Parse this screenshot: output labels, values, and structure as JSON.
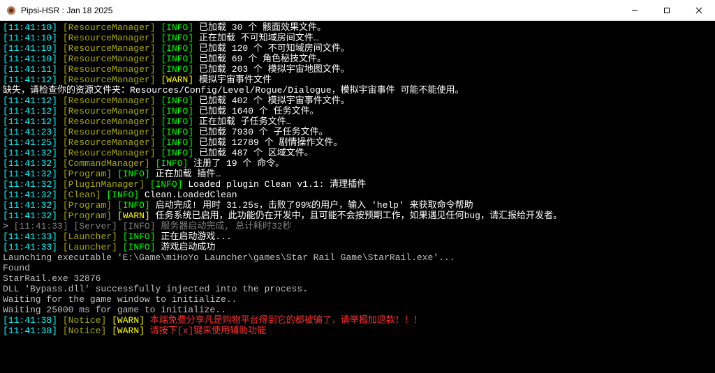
{
  "window": {
    "title": "Pipsi-HSR : Jan 18 2025"
  },
  "lines": [
    {
      "ts": "11:41:10",
      "src": "ResourceManager",
      "srcClass": "c-dkyel",
      "lvl": "INFO",
      "lvlClass": "c-green",
      "msg": "已加载 30 个 骸面效果文件。",
      "msgClass": "c-white"
    },
    {
      "ts": "11:41:10",
      "src": "ResourceManager",
      "srcClass": "c-dkyel",
      "lvl": "INFO",
      "lvlClass": "c-green",
      "msg": "正在加载 不可知域房间文件…",
      "msgClass": "c-white"
    },
    {
      "ts": "11:41:10",
      "src": "ResourceManager",
      "srcClass": "c-dkyel",
      "lvl": "INFO",
      "lvlClass": "c-green",
      "msg": "已加载 120 个 不可知域房间文件。",
      "msgClass": "c-white"
    },
    {
      "ts": "11:41:10",
      "src": "ResourceManager",
      "srcClass": "c-dkyel",
      "lvl": "INFO",
      "lvlClass": "c-green",
      "msg": "已加载 69 个 角色秘技文件。",
      "msgClass": "c-white"
    },
    {
      "ts": "11:41:11",
      "src": "ResourceManager",
      "srcClass": "c-dkyel",
      "lvl": "INFO",
      "lvlClass": "c-green",
      "msg": "已加载 203 个 模拟宇宙地图文件。",
      "msgClass": "c-white"
    },
    {
      "ts": "11:41:12",
      "src": "ResourceManager",
      "srcClass": "c-dkyel",
      "lvl": "WARN",
      "lvlClass": "c-yellow",
      "msg": "模拟宇宙事件文件",
      "msgClass": "c-white"
    },
    {
      "plain": true,
      "msg": "缺失，请检查你的资源文件夹：Resources/Config/Level/Rogue/Dialogue，模拟宇宙事件 可能不能使用。",
      "msgClass": "c-white"
    },
    {
      "ts": "11:41:12",
      "src": "ResourceManager",
      "srcClass": "c-dkyel",
      "lvl": "INFO",
      "lvlClass": "c-green",
      "msg": "已加载 402 个 模拟宇宙事件文件。",
      "msgClass": "c-white"
    },
    {
      "ts": "11:41:12",
      "src": "ResourceManager",
      "srcClass": "c-dkyel",
      "lvl": "INFO",
      "lvlClass": "c-green",
      "msg": "已加载 1640 个 任务文件。",
      "msgClass": "c-white"
    },
    {
      "ts": "11:41:12",
      "src": "ResourceManager",
      "srcClass": "c-dkyel",
      "lvl": "INFO",
      "lvlClass": "c-green",
      "msg": "正在加载 子任务文件…",
      "msgClass": "c-white"
    },
    {
      "ts": "11:41:23",
      "src": "ResourceManager",
      "srcClass": "c-dkyel",
      "lvl": "INFO",
      "lvlClass": "c-green",
      "msg": "已加载 7930 个 子任务文件。",
      "msgClass": "c-white"
    },
    {
      "ts": "11:41:25",
      "src": "ResourceManager",
      "srcClass": "c-dkyel",
      "lvl": "INFO",
      "lvlClass": "c-green",
      "msg": "已加载 12789 个 剧情操作文件。",
      "msgClass": "c-white"
    },
    {
      "ts": "11:41:32",
      "src": "ResourceManager",
      "srcClass": "c-dkyel",
      "lvl": "INFO",
      "lvlClass": "c-green",
      "msg": "已加载 487 个 区域文件。",
      "msgClass": "c-white"
    },
    {
      "ts": "11:41:32",
      "src": "CommandManager",
      "srcClass": "c-dkyel",
      "lvl": "INFO",
      "lvlClass": "c-green",
      "msg": "注册了 19 个 命令。",
      "msgClass": "c-white"
    },
    {
      "ts": "11:41:32",
      "src": "Program",
      "srcClass": "c-dkyel",
      "lvl": "INFO",
      "lvlClass": "c-green",
      "msg": "正在加载 插件…",
      "msgClass": "c-white"
    },
    {
      "ts": "11:41:32",
      "src": "PluginManager",
      "srcClass": "c-dkyel",
      "lvl": "INFO",
      "lvlClass": "c-green",
      "msg": "Loaded plugin Clean v1.1: 清理插件",
      "msgClass": "c-white"
    },
    {
      "ts": "11:41:32",
      "src": "Clean",
      "srcClass": "c-dkyel",
      "lvl": "INFO",
      "lvlClass": "c-green",
      "msg": "Clean.LoadedClean",
      "msgClass": "c-white"
    },
    {
      "ts": "11:41:32",
      "src": "Program",
      "srcClass": "c-dkyel",
      "lvl": "INFO",
      "lvlClass": "c-green",
      "msg": "启动完成! 用时 31.25s，击败了99%的用户，输入 'help' 来获取命令帮助",
      "msgClass": "c-white"
    },
    {
      "ts": "11:41:32",
      "src": "Program",
      "srcClass": "c-dkyel",
      "lvl": "WARN",
      "lvlClass": "c-yellow",
      "msg": "任务系统已启用，此功能仍在开发中，且可能不会按预期工作，如果遇见任何bug，请汇报给开发者。",
      "msgClass": "c-white"
    },
    {
      "prompt": "> ",
      "ts": "11:41:33",
      "tsClass": "c-dim",
      "src": "Server",
      "srcClass": "c-dim",
      "lvl": "INFO",
      "lvlClass": "c-dim",
      "msg": "服务器启动完成, 总计耗时32秒",
      "msgClass": "c-dim"
    },
    {
      "ts": "11:41:33",
      "src": "Launcher",
      "srcClass": "c-dkyel",
      "lvl": "INFO",
      "lvlClass": "c-green",
      "msg": "正在启动游戏...",
      "msgClass": "c-white"
    },
    {
      "ts": "11:41:33",
      "src": "Launcher",
      "srcClass": "c-dkyel",
      "lvl": "INFO",
      "lvlClass": "c-green",
      "msg": "游戏启动成功",
      "msgClass": "c-white"
    },
    {
      "plain": true,
      "msg": "Launching executable 'E:\\Game\\miHoYo Launcher\\games\\Star Rail Game\\StarRail.exe'...",
      "msgClass": "c-gray"
    },
    {
      "plain": true,
      "msg": "Found",
      "msgClass": "c-gray"
    },
    {
      "plain": true,
      "msg": "StarRail.exe 32876",
      "msgClass": "c-gray"
    },
    {
      "plain": true,
      "msg": "DLL 'Bypass.dll' successfully injected into the process.",
      "msgClass": "c-gray"
    },
    {
      "plain": true,
      "msg": "Waiting for the game window to initialize..",
      "msgClass": "c-gray"
    },
    {
      "plain": true,
      "msg": "Waiting 25000 ms for game to initialize..",
      "msgClass": "c-gray"
    },
    {
      "ts": "11:41:38",
      "src": "Notice",
      "srcClass": "c-dkyel",
      "lvl": "WARN",
      "lvlClass": "c-yellow",
      "msg": "本端免费分享凡是购物平台得到它的都被骗了，请举报加退款！！！",
      "msgClass": "c-red"
    },
    {
      "ts": "11:41:38",
      "src": "Notice",
      "srcClass": "c-dkyel",
      "lvl": "WARN",
      "lvlClass": "c-yellow",
      "msg": "请按下[x]键来使用辅助功能",
      "msgClass": "c-red"
    }
  ]
}
